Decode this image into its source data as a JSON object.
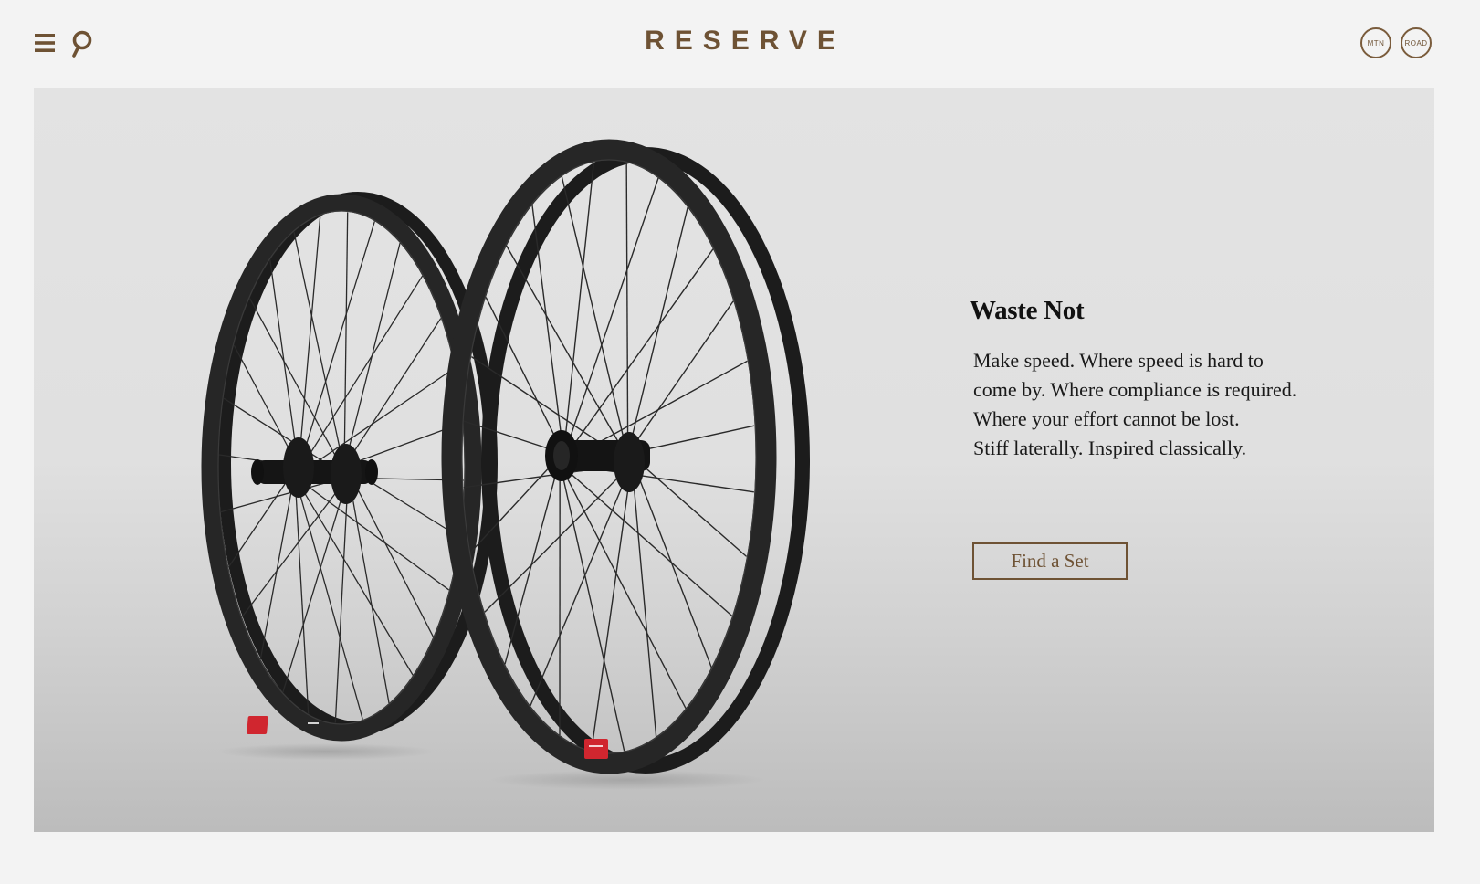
{
  "header": {
    "menu_icon": "hamburger-menu-icon",
    "search_icon": "search-icon",
    "logo": "RESERVE",
    "switcher": {
      "mtn_label": "MTN",
      "road_label": "ROAD"
    }
  },
  "hero": {
    "image": "carbon-bicycle-wheelset",
    "headline": "Waste Not",
    "body_lines": [
      "Make speed. Where speed is hard to",
      "come by. Where compliance is required.",
      "Where your effort cannot be lost.",
      "Stiff laterally. Inspired classically."
    ],
    "cta_label": "Find a Set"
  },
  "colors": {
    "brand": "#6e5234",
    "page_background": "#f3f3f3",
    "rim": "#222222",
    "decal": "#d0262f"
  }
}
